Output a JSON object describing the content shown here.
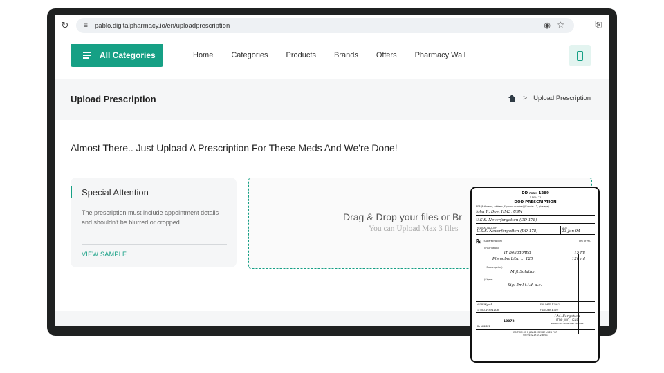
{
  "browser": {
    "url": "pablo.digitalpharmacy.io/en/uploadprescription",
    "icons": [
      "reload-icon",
      "tune-icon",
      "location-pin-icon",
      "star-icon",
      "extensions-icon"
    ]
  },
  "header": {
    "all_categories_label": "All Categories",
    "nav": [
      "Home",
      "Categories",
      "Products",
      "Brands",
      "Offers",
      "Pharmacy Wall"
    ],
    "accent_color": "#16a085"
  },
  "title_band": {
    "page_title": "Upload Prescription",
    "breadcrumb_current": "Upload Prescription",
    "breadcrumb_separator": ">"
  },
  "main": {
    "headline": "Almost There.. Just Upload A Prescription For These Meds And We're Done!",
    "attention": {
      "heading": "Special Attention",
      "body": "The prescription must include appointment details and shouldn't be blurred or cropped.",
      "link": "VIEW SAMPLE"
    },
    "dropzone": {
      "title": "Drag & Drop your files or Br",
      "subtitle": "You can Upload Max 3 files"
    }
  },
  "sample": {
    "form_id": "DD",
    "form_word": "FORM",
    "form_number": "1289",
    "form_date": "1 NOV 71",
    "title": "DOD PRESCRIPTION",
    "for_label": "FOR (Full name, address, & phone number) (If under 12, give age)",
    "patient": "John R. Doe, HM3, USN",
    "ship": "U.S.S. Neverforgotten (DD 178)",
    "facility_label": "MEDICAL FACILITY",
    "facility": "U.S.S. Neverforgotten (DD 178)",
    "date_label": "DATE",
    "date": "23 Jun 94",
    "rx_symbol": "℞",
    "superscription": "(Superscription)",
    "units": "gm or ml.",
    "inscription": "(Inscription)",
    "drug1": "Tr Belladonna",
    "dose1": "15 ml",
    "drug2": "Phenobarbital ... 120",
    "dose2": "120 ml",
    "subscription": "(Subscription)",
    "sub_text": "M ft Solution",
    "signa": "(Signa)",
    "sig_text": "Sig: 5ml t.i.d. a.c.",
    "mfgr_label": "MFGR",
    "mfgr": "Wyeth",
    "lot_label": "LOT NO.",
    "lot": "P39X106",
    "exp_label": "EXP DATE",
    "exp": "12/02",
    "filled_label": "FILLED BY",
    "filled": "EMT",
    "rx_number": "10072",
    "rx_number_label": "Rx NUMBER",
    "signature": "I.M. Forgotten",
    "signer": "LTDR, MC, USNR",
    "sig_label": "SIGNATURE  RANK  AND DEGREE",
    "edition": "EDITION OF 1 JAN 66 MAY BE USED  FOR",
    "stock": "S/N  0102-LF-012-8201"
  }
}
